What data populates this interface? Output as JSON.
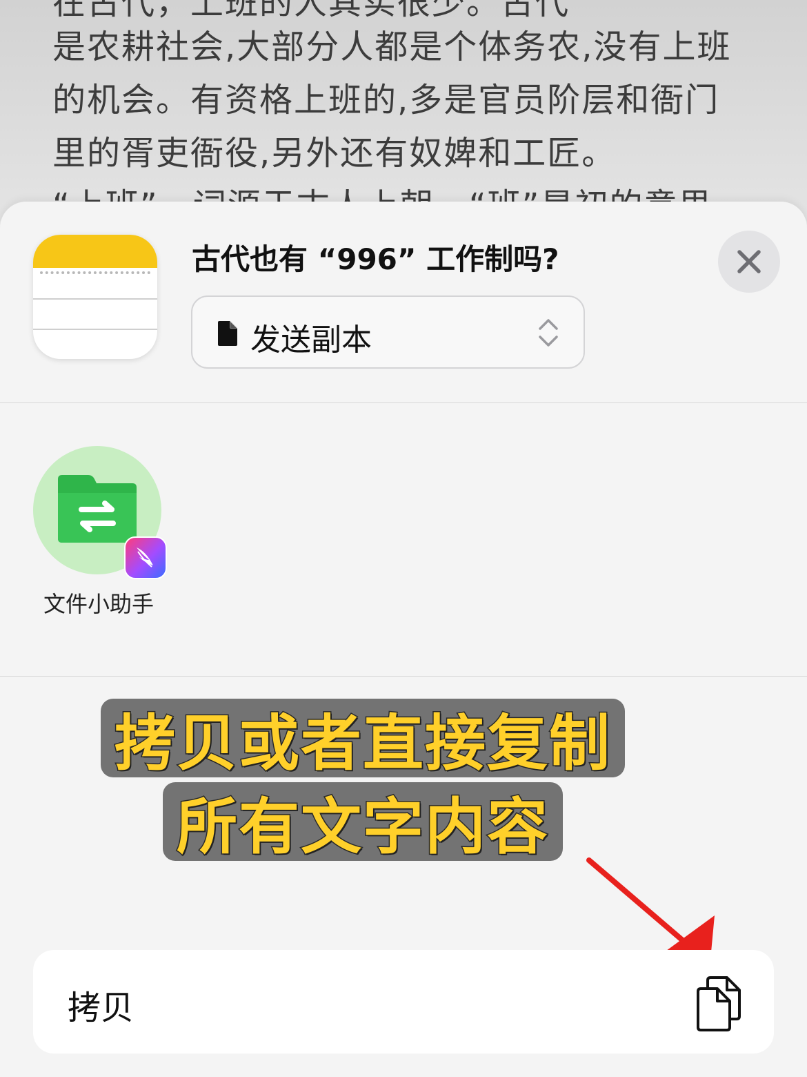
{
  "background_note": {
    "lines": [
      "在古代，上班的人其实很少。古代",
      "是农耕社会,大部分人都是个体务农,没有上班",
      "的机会。有资格上班的,多是官员阶层和衙门",
      "里的胥吏衙役,另外还有奴婢和工匠。",
      "“上班”一词源于古人上朝，“班”是初的意思"
    ]
  },
  "share_sheet": {
    "title": "古代也有 “996” 工作制吗?",
    "mode_select": {
      "value": "发送副本",
      "icon": "document-icon"
    },
    "close_icon": "close-icon",
    "targets": [
      {
        "label": "文件小助手",
        "icon": "file-transfer-folder-icon",
        "badge": "feishu-badge-icon"
      }
    ],
    "actions": [
      {
        "label": "拷贝",
        "icon": "copy-icon"
      }
    ]
  },
  "overlay": {
    "caption_line1": "拷贝或者直接复制",
    "caption_line2": "所有文字内容",
    "arrow_color": "#e8211d"
  },
  "colors": {
    "notes_yellow": "#f7c617",
    "caption_text": "#ffd02a",
    "target_circle": "#c8eec2",
    "folder_green": "#2fb54a"
  }
}
